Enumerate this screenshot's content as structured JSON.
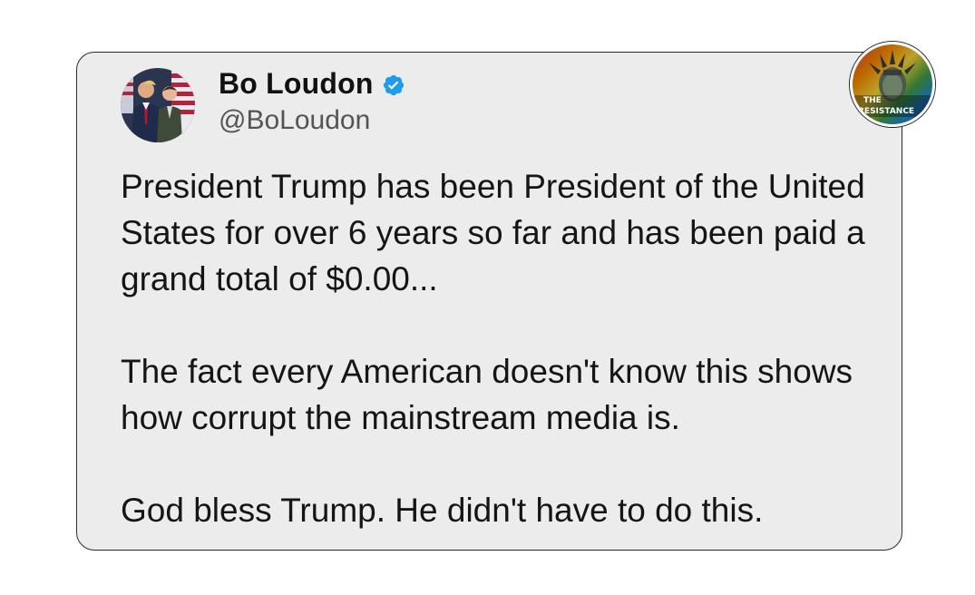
{
  "tweet": {
    "display_name": "Bo Loudon",
    "handle": "@BoLoudon",
    "verified": true,
    "avatar_icon": "profile-photo",
    "paragraphs": [
      "President Trump has been President of the United States for over 6 years so far and has been paid a grand total of $0.00...",
      "The fact every American doesn't know this shows how corrupt the mainstream media is.",
      "God bless Trump. He didn't have to do this."
    ]
  },
  "watermark": {
    "line1": "THE",
    "line2": "RESISTANCE"
  },
  "colors": {
    "verified_blue": "#1d9bf0",
    "card_background": "#ececec",
    "card_border": "#2b2b2b"
  }
}
